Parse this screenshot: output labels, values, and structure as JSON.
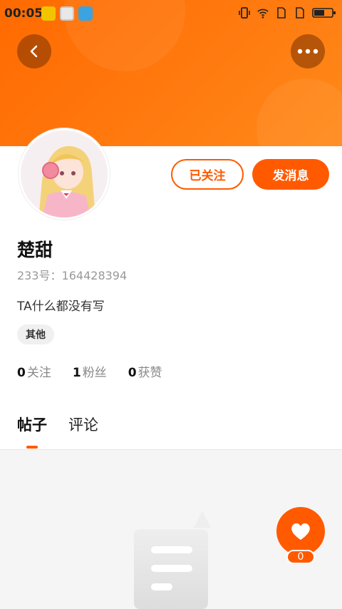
{
  "status_bar": {
    "time": "00:05"
  },
  "profile": {
    "name": "楚甜",
    "uid": "233号：164428394",
    "bio": "TA什么都没有写",
    "tag": "其他"
  },
  "actions": {
    "follow_label": "已关注",
    "message_label": "发消息"
  },
  "stats": [
    {
      "value": "0",
      "label": "关注"
    },
    {
      "value": "1",
      "label": "粉丝"
    },
    {
      "value": "0",
      "label": "获赞"
    }
  ],
  "tabs": [
    {
      "label": "帖子",
      "active": true
    },
    {
      "label": "评论",
      "active": false
    }
  ],
  "like": {
    "count": "0"
  },
  "colors": {
    "accent": "#ff5a00"
  }
}
